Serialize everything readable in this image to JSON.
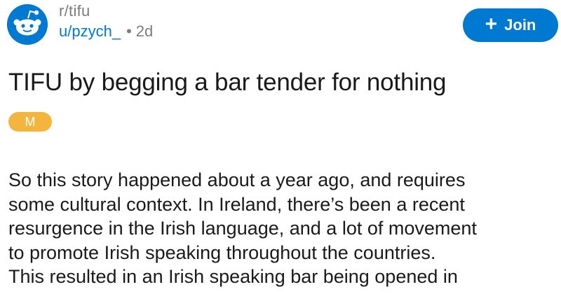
{
  "post": {
    "subreddit": "r/tifu",
    "username": "u/pzych_",
    "separator": "•",
    "age": "2d",
    "join_label": "Join",
    "title": "TIFU by begging a bar tender for nothing",
    "flair": "M",
    "body_lines": [
      "So this story happened about a year ago, and requires",
      "some cultural context. In Ireland, there’s been a recent",
      "resurgence in the Irish language, and a lot of movement",
      "to promote Irish speaking throughout the countries.",
      "This resulted in an Irish speaking bar being opened in"
    ]
  },
  "colors": {
    "brand_blue": "#0079d3",
    "flair_yellow": "#f4b53e",
    "meta_gray": "#7c7c7c"
  },
  "icons": {
    "avatar": "reddit-snoo-icon",
    "join": "plus-icon"
  }
}
